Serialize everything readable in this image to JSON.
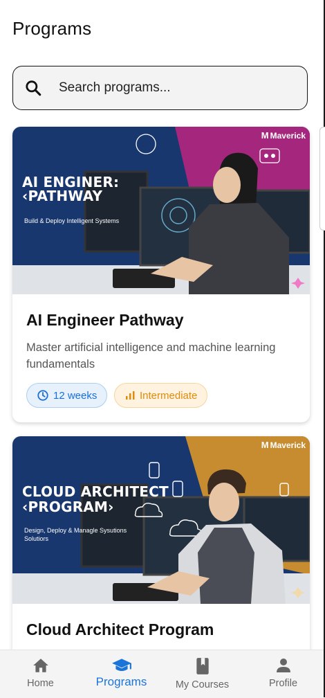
{
  "header": {
    "title": "Programs"
  },
  "search": {
    "placeholder": "Search programs..."
  },
  "programs": [
    {
      "banner_brand": "Maverick",
      "banner_title_line1": "AI ENGINER:",
      "banner_title_line2": "‹PATHWAY",
      "banner_subtitle": "Build & Deploy Intelligent Systems",
      "title": "AI Engineer Pathway",
      "description": "Master artificial intelligence and machine learning fundamentals",
      "duration": "12 weeks",
      "level": "Intermediate",
      "accent_color": "#c0288a"
    },
    {
      "banner_brand": "Maverick",
      "banner_title_line1": "CLOUD ARCHITECT",
      "banner_title_line2": "‹PROGRAM›",
      "banner_subtitle": "Design, Deploy & Managle Sysutions Solutiors",
      "title": "Cloud Architect Program",
      "accent_color": "#e8a030"
    }
  ],
  "nav": {
    "items": [
      {
        "label": "Home",
        "icon": "home-icon"
      },
      {
        "label": "Programs",
        "icon": "graduation-cap-icon",
        "active": true
      },
      {
        "label": "My Courses",
        "icon": "book-icon"
      },
      {
        "label": "Profile",
        "icon": "person-icon"
      }
    ],
    "active_color": "#1b74d8"
  }
}
